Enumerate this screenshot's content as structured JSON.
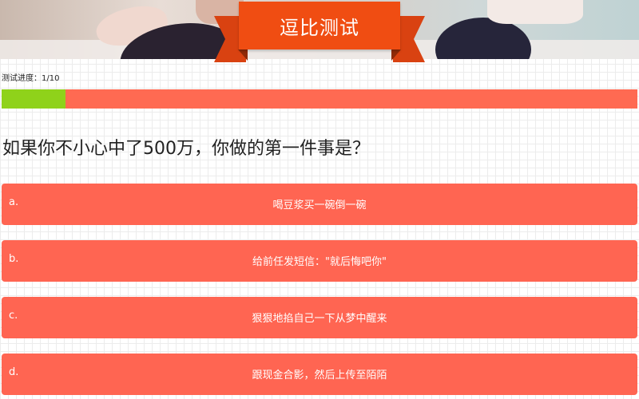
{
  "header": {
    "title": "逗比测试"
  },
  "progress": {
    "label": "测试进度：1/10",
    "fraction": 0.1,
    "fill_color": "#8fd21a",
    "track_color": "#ff6a52"
  },
  "question": {
    "text": "如果你不小心中了500万，你做的第一件事是？"
  },
  "options": [
    {
      "letter": "a.",
      "text": "喝豆浆买一碗倒一碗"
    },
    {
      "letter": "b.",
      "text": "给前任发短信：\"就后悔吧你\""
    },
    {
      "letter": "c.",
      "text": "狠狠地掐自己一下从梦中醒来"
    },
    {
      "letter": "d.",
      "text": "跟现金合影，然后上传至陌陌"
    }
  ],
  "colors": {
    "ribbon": "#f04d12",
    "option_bg": "#ff6552"
  }
}
